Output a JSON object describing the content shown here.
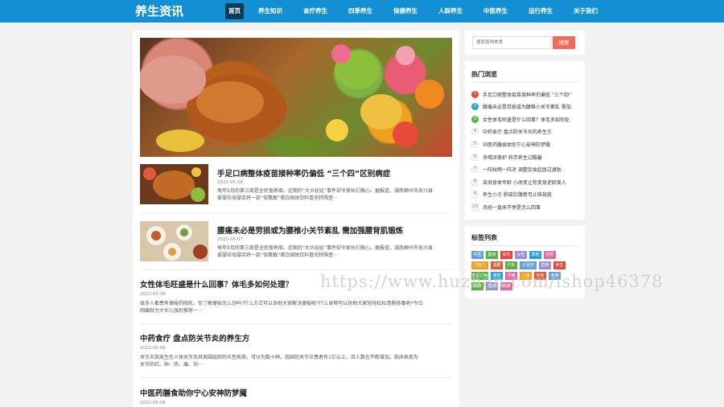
{
  "header": {
    "logo": "养生资讯",
    "nav": [
      {
        "label": "首页",
        "active": true
      },
      {
        "label": "养生知识"
      },
      {
        "label": "食疗养生"
      },
      {
        "label": "四季养生"
      },
      {
        "label": "保健养生"
      },
      {
        "label": "人群养生"
      },
      {
        "label": "中医养生"
      },
      {
        "label": "运行养生"
      },
      {
        "label": "关于我们"
      }
    ]
  },
  "articles": [
    {
      "title": "手足口病整体疫苗接种率仍偏低 “三个四”区别病症",
      "date": "2022-05-08",
      "summary_line1": "每年5月的第三周是全民营养周。近期的“大头娃娃”事件却令家长们揪心。据报道，湖南郴州市永兴县",
      "summary_line2": "爱婴坊母婴店将一款“倍氨敏”蛋白固体饮料冒充特殊医···"
    },
    {
      "title": "腰痛未必是劳损或为腰椎小关节紊乱 需加强腰背肌锻炼",
      "date": "2022-05-07",
      "summary_line1": "每年5月的第三周是全民营养周。近期的“大头娃娃”事件却令家长们揪心。据报道，湖南郴州市永兴县",
      "summary_line2": "爱婴坊母婴店将一款“倍氨敏”蛋白固体饮料冒充特殊医···"
    },
    {
      "title": "女性体毛旺盛是什么回事？体毛多如何处理？",
      "date": "2022-05-06",
      "summary_line1": "很多人都患有便秘的困扰，你了解便秘怎么办吗?什么方式可以协助大家解决便秘呢?什么食物可以协助大家轻轻松松清肠排毒呢?今日",
      "summary_line2": "网编就为大伙儿强烈推荐一···"
    },
    {
      "title": "中药食疗 盘点防关节炎的养生方",
      "date": "2022-05-06",
      "summary_line1": "关节炎指发生在人体关节及其周围组织的炎性疾病，可分为数十种。我国的关节炎患者有1亿以上，且人数在不断增加。临床表现为",
      "summary_line2": "关节的红、肿、热、痛、功···"
    },
    {
      "title": "中医药膳食助你宁心安神防梦魇",
      "date": "2022-05-06"
    }
  ],
  "search": {
    "placeholder": "搜索喜种美食",
    "button": "搜索"
  },
  "hot": {
    "title": "热门浏览",
    "items": [
      {
        "num": "1",
        "text": "手足口病整体疫苗接种率仍偏低 “三个四”"
      },
      {
        "num": "2",
        "text": "腰痛未必是劳损或为腰椎小关节紊乱 需加"
      },
      {
        "num": "3",
        "text": "女性体毛旺盛是什么回事？体毛多如何处"
      },
      {
        "num": "4",
        "text": "中药食疗 盘点防关节炎的养生方"
      },
      {
        "num": "5",
        "text": "中医药膳食助你宁心安神防梦魇"
      },
      {
        "num": "6",
        "text": "多喝凉茶护 科学养生过酷暑"
      },
      {
        "num": "7",
        "text": "一阵秋雨一阵凉 调整饮食起居过渡秋"
      },
      {
        "num": "8",
        "text": "自测身体年龄 小改变让你变身逆龄美人"
      },
      {
        "num": "9",
        "text": "养生小方 肺皮肛髋者可止咳祛痰"
      },
      {
        "num": "10",
        "text": "月经一直来不停是怎么回事"
      }
    ]
  },
  "tags": {
    "title": "标签列表",
    "items": [
      "中医",
      "膳食",
      "体毛",
      "女性",
      "草药",
      "舒肝",
      "巧克力",
      "减肥",
      "户外",
      "三伏天",
      "营养",
      "养生",
      "手足口病",
      "感冒",
      "牙痛",
      "上班",
      "饮食",
      "冬季",
      "颈椎",
      "健身",
      "咳嗽"
    ]
  },
  "watermark": "https://www.huzhan.com/ishop46378",
  "colors": {
    "header": "#1390d4",
    "nav_active": "#0d3a57",
    "search_button": "#f26a5a",
    "rank1": "#e8453c",
    "rank2": "#2aa0d8",
    "rank3": "#5ab14a"
  }
}
